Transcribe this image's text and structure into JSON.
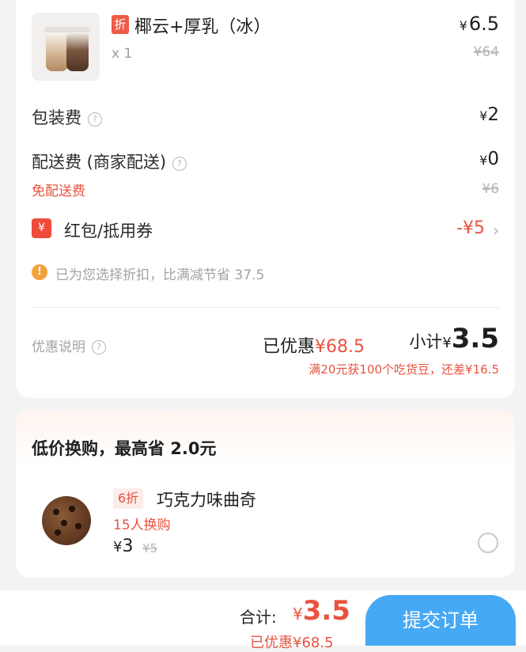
{
  "order": {
    "product": {
      "tag": "折",
      "name": "椰云+厚乳（冰）",
      "qty": "x 1",
      "currency": "¥",
      "price": "6.5",
      "original_price": "¥64"
    },
    "packaging": {
      "label": "包装费",
      "currency": "¥",
      "value": "2"
    },
    "delivery": {
      "label": "配送费 (商家配送)",
      "currency": "¥",
      "value": "0",
      "free_label": "免配送费",
      "original": "¥6"
    },
    "coupon": {
      "icon": "¥",
      "label": "红包/抵用券",
      "value": "-¥5"
    },
    "notice": {
      "icon": "!",
      "text": "已为您选择折扣，比满减节省 37.5"
    },
    "summary": {
      "desc_label": "优惠说明",
      "saved_label": "已优惠",
      "saved_value": "¥68.5",
      "subtotal_label": "小计",
      "currency": "¥",
      "subtotal_value": "3.5",
      "beans_note": "满20元获100个吃货豆，还差¥16.5"
    }
  },
  "exchange": {
    "title": "低价换购，最高省 2.0元",
    "item": {
      "discount_tag": "6折",
      "name": "巧克力味曲奇",
      "count": "15人换购",
      "currency": "¥",
      "price": "3",
      "original_price": "¥5"
    }
  },
  "footer": {
    "total_label": "合计:",
    "currency": "¥",
    "total_value": "3.5",
    "saved_text": "已优惠¥68.5",
    "submit_label": "提交订单"
  },
  "colors": {
    "accent_red": "#e8533f",
    "submit_blue": "#46a9f5",
    "warning": "#f2a23c"
  }
}
